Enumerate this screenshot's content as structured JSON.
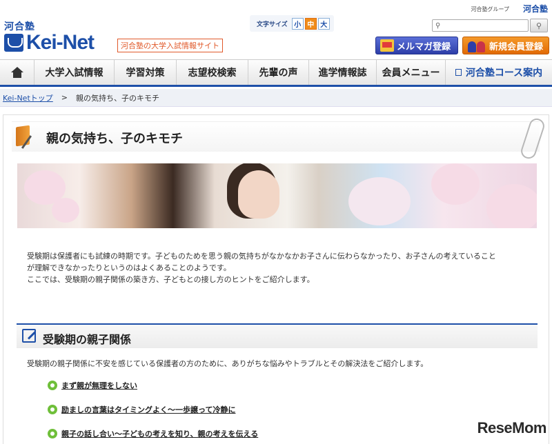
{
  "top": {
    "group_label": "河合塾グループ",
    "group_logo": "河合塾"
  },
  "header": {
    "brand_kawai": "河合塾",
    "brand_name": "Kei-Net",
    "tagline": "河合塾の大学入試情報サイト",
    "font_size": {
      "label": "文字サイズ",
      "small": "小",
      "medium": "中",
      "large": "大",
      "selected": "中"
    },
    "search": {
      "placeholder": "",
      "button_icon": "magnifier-icon"
    },
    "mailmag_button": "メルマガ登録",
    "register_button": "新規会員登録"
  },
  "nav": {
    "items": [
      {
        "label": "大学入試情報"
      },
      {
        "label": "学習対策"
      },
      {
        "label": "志望校検索"
      },
      {
        "label": "先輩の声"
      },
      {
        "label": "進学情報誌"
      },
      {
        "label": "会員メニュー"
      },
      {
        "label": "河合塾コース案内"
      }
    ]
  },
  "breadcrumb": {
    "home": "Kei-Netトップ",
    "separator": ">",
    "current": "親の気持ち、子のキモチ"
  },
  "page": {
    "title": "親の気持ち、子のキモチ",
    "intro_1": "受験期は保護者にも試練の時期です。子どものためを思う親の気持ちがなかなかお子さんに伝わらなかったり、お子さんの考えていること",
    "intro_2": "が理解できなかったりというのはよくあることのようです。",
    "intro_3": "ここでは、受験期の親子関係の築き方、子どもとの接し方のヒントをご紹介します。"
  },
  "section": {
    "title": "受験期の親子関係",
    "desc": "受験期の親子関係に不安を感じている保護者の方のために、ありがちな悩みやトラブルとその解決法をご紹介します。",
    "topics": [
      {
        "label": "まず親が無理をしない"
      },
      {
        "label": "励ましの言葉はタイミングよく～一歩譲って冷静に"
      },
      {
        "label": "親子の話し合い～子どもの考えを知り、親の考えを伝える"
      }
    ]
  },
  "watermark": "ReseMom",
  "colors": {
    "brand_blue": "#1d4fa8",
    "accent_orange": "#f08c1a",
    "bullet_green": "#6fbf3a"
  }
}
